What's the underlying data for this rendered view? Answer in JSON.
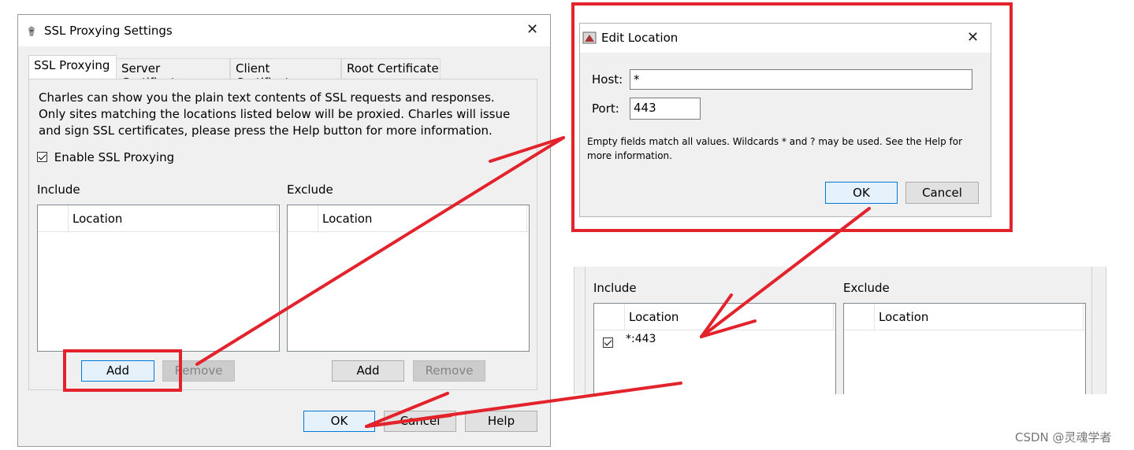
{
  "ssl_dialog": {
    "title": "SSL Proxying Settings",
    "tabs": [
      "SSL Proxying",
      "Server Certificates",
      "Client Certificates",
      "Root Certificate"
    ],
    "description": "Charles can show you the plain text contents of SSL requests and responses. Only sites matching the locations listed below will be proxied. Charles will issue and sign SSL certificates, please press the Help button for more information.",
    "enable_label": "Enable SSL Proxying",
    "include_label": "Include",
    "exclude_label": "Exclude",
    "column_location": "Location",
    "add_label": "Add",
    "remove_label": "Remove",
    "ok_label": "OK",
    "cancel_label": "Cancel",
    "help_label": "Help"
  },
  "edit_location": {
    "title": "Edit Location",
    "host_label": "Host:",
    "host_value": "*",
    "port_label": "Port:",
    "port_value": "443",
    "note": "Empty fields match all values. Wildcards * and ? may be used. See the Help for more information.",
    "ok_label": "OK",
    "cancel_label": "Cancel"
  },
  "result_panel": {
    "include_label": "Include",
    "exclude_label": "Exclude",
    "column_location": "Location",
    "row_value": "*:443"
  },
  "watermark": "CSDN @灵魂学者",
  "colors": {
    "annotation_red": "#e3232c",
    "primary_border": "#0078d7"
  }
}
